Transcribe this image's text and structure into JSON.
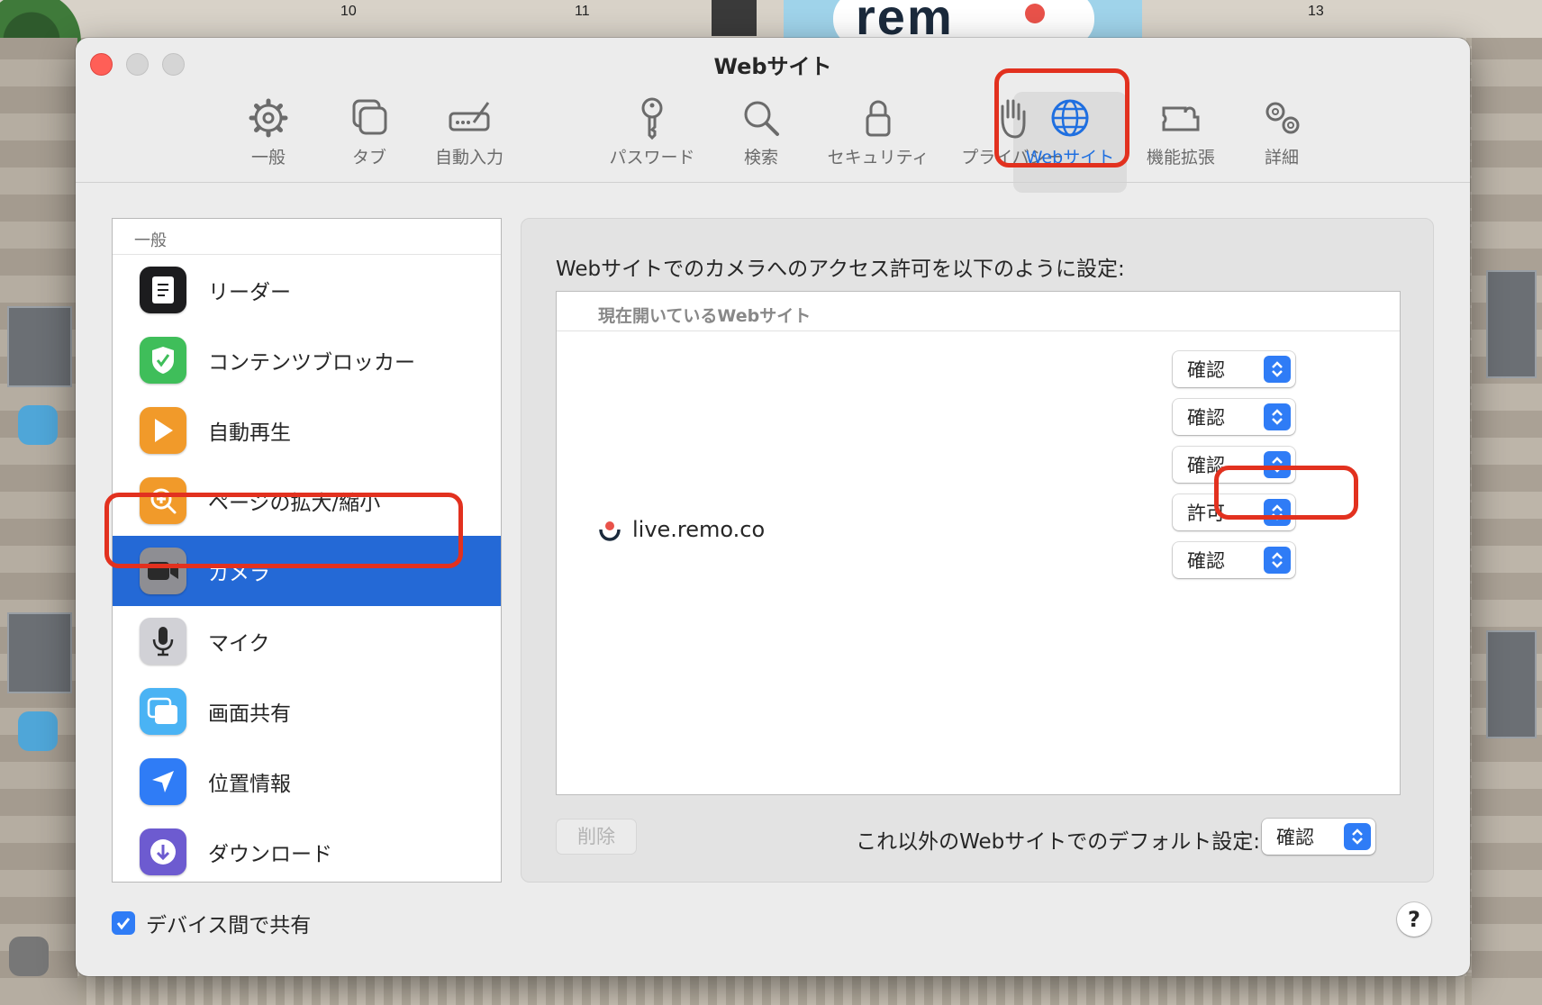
{
  "background": {
    "numbers": [
      "10",
      "11",
      "13"
    ],
    "logo_text": "rem"
  },
  "window": {
    "title": "Webサイト"
  },
  "toolbar": {
    "items": [
      {
        "label": "一般",
        "icon": "gear-icon"
      },
      {
        "label": "タブ",
        "icon": "tabs-icon"
      },
      {
        "label": "自動入力",
        "icon": "autofill-icon"
      },
      {
        "label": "パスワード",
        "icon": "key-icon"
      },
      {
        "label": "検索",
        "icon": "search-icon"
      },
      {
        "label": "セキュリティ",
        "icon": "lock-icon"
      },
      {
        "label": "プライバシー",
        "icon": "hand-icon"
      },
      {
        "label": "Webサイト",
        "icon": "globe-icon",
        "active": true
      },
      {
        "label": "機能拡張",
        "icon": "puzzle-icon"
      },
      {
        "label": "詳細",
        "icon": "gears-icon"
      }
    ],
    "active_color": "#1f6fe0"
  },
  "sidebar": {
    "header": "一般",
    "items": [
      {
        "label": "リーダー",
        "icon": "reader-icon"
      },
      {
        "label": "コンテンツブロッカー",
        "icon": "content-blocker-icon"
      },
      {
        "label": "自動再生",
        "icon": "autoplay-icon"
      },
      {
        "label": "ページの拡大/縮小",
        "icon": "zoom-icon"
      },
      {
        "label": "カメラ",
        "icon": "camera-icon",
        "selected": true
      },
      {
        "label": "マイク",
        "icon": "microphone-icon"
      },
      {
        "label": "画面共有",
        "icon": "screen-share-icon"
      },
      {
        "label": "位置情報",
        "icon": "location-icon"
      },
      {
        "label": "ダウンロード",
        "icon": "download-icon"
      }
    ],
    "selected_color": "#2469d6"
  },
  "panel": {
    "description": "Webサイトでのカメラへのアクセス許可を以下のように設定:",
    "list_header": "現在開いているWebサイト",
    "site": {
      "name": "live.remo.co",
      "favicon": "remo-icon"
    },
    "popups": [
      "確認",
      "確認",
      "確認",
      "許可",
      "確認"
    ],
    "delete_label": "削除",
    "default_label": "これ以外のWebサイトでのデフォルト設定:",
    "default_value": "確認"
  },
  "footer": {
    "share_label": "デバイス間で共有",
    "share_checked": true,
    "help_label": "?"
  },
  "colors": {
    "highlight": "#e2311f",
    "accent": "#2f7cf6"
  }
}
